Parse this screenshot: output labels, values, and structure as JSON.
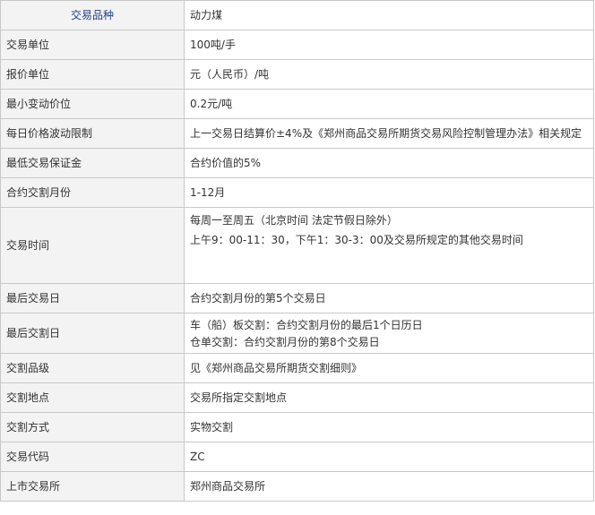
{
  "header": {
    "label": "交易品种",
    "value": "动力煤"
  },
  "rows": [
    {
      "label": "交易单位",
      "lines": [
        "100吨/手"
      ]
    },
    {
      "label": "报价单位",
      "lines": [
        "元（人民币）/吨"
      ]
    },
    {
      "label": "最小变动价位",
      "lines": [
        "0.2元/吨"
      ]
    },
    {
      "label": "每日价格波动限制",
      "lines": [
        "上一交易日结算价±4%及《郑州商品交易所期货交易风险控制管理办法》相关规定"
      ]
    },
    {
      "label": "最低交易保证金",
      "lines": [
        "合约价值的5%"
      ]
    },
    {
      "label": "合约交割月份",
      "lines": [
        "1-12月"
      ]
    },
    {
      "label": "交易时间",
      "lines": [
        "每周一至周五（北京时间 法定节假日除外）",
        "上午9：00-11：30，下午1：30-3：00及交易所规定的其他交易时间"
      ]
    },
    {
      "label": "最后交易日",
      "lines": [
        "合约交割月份的第5个交易日"
      ]
    },
    {
      "label": "最后交割日",
      "lines": [
        "车（船）板交割：合约交割月份的最后1个日历日",
        "仓单交割：合约交割月份的第8个交易日"
      ]
    },
    {
      "label": "交割品级",
      "lines": [
        "见《郑州商品交易所期货交割细则》"
      ]
    },
    {
      "label": "交割地点",
      "lines": [
        "交易所指定交割地点"
      ]
    },
    {
      "label": "交割方式",
      "lines": [
        "实物交割"
      ]
    },
    {
      "label": "交易代码",
      "lines": [
        "ZC"
      ]
    },
    {
      "label": "上市交易所",
      "lines": [
        "郑州商品交易所"
      ]
    }
  ]
}
